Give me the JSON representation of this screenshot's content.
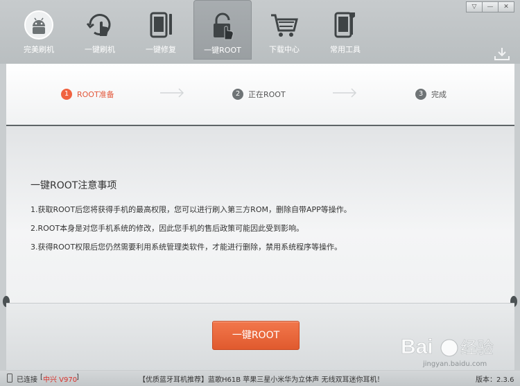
{
  "toolbar": {
    "items": [
      {
        "label": "完美刷机",
        "icon": "android-icon"
      },
      {
        "label": "一键刷机",
        "icon": "refresh-hand-icon"
      },
      {
        "label": "一键修复",
        "icon": "tablet-tool-icon"
      },
      {
        "label": "一键ROOT",
        "icon": "lock-icon",
        "active": true
      },
      {
        "label": "下载中心",
        "icon": "cart-icon"
      },
      {
        "label": "常用工具",
        "icon": "tablet-wrench-icon"
      }
    ],
    "window_buttons": [
      "▽",
      "—",
      "✕"
    ]
  },
  "steps": [
    {
      "num": "1",
      "label": "ROOT准备",
      "state": "active"
    },
    {
      "num": "2",
      "label": "正在ROOT",
      "state": "pending"
    },
    {
      "num": "3",
      "label": "完成",
      "state": "pending"
    }
  ],
  "notice": {
    "title": "一键ROOT注意事项",
    "lines": [
      "1.获取ROOT后您将获得手机的最高权限，您可以进行刷入第三方ROM，删除自带APP等操作。",
      "2.ROOT本身是对您手机系统的修改，因此您手机的售后政策可能因此受到影响。",
      "3.获得ROOT权限后您仍然需要利用系统管理类软件，才能进行删除，禁用系统程序等操作。"
    ]
  },
  "action": {
    "root_button": "一键ROOT"
  },
  "statusbar": {
    "connected_label": "已连接",
    "device_open": "[",
    "device": "中兴 V970",
    "device_close": "]",
    "ad": "【优质蓝牙耳机推荐】蓝歌H61B 苹果三星小米华为立体声 无线双耳迷你耳机！",
    "version": "版本：2.3.6"
  },
  "watermark": {
    "text": "jingyan.baidu.com",
    "logo": "Bai 经验"
  },
  "colors": {
    "accent": "#f06240",
    "button": "#e8643a",
    "device": "#d8302a"
  }
}
